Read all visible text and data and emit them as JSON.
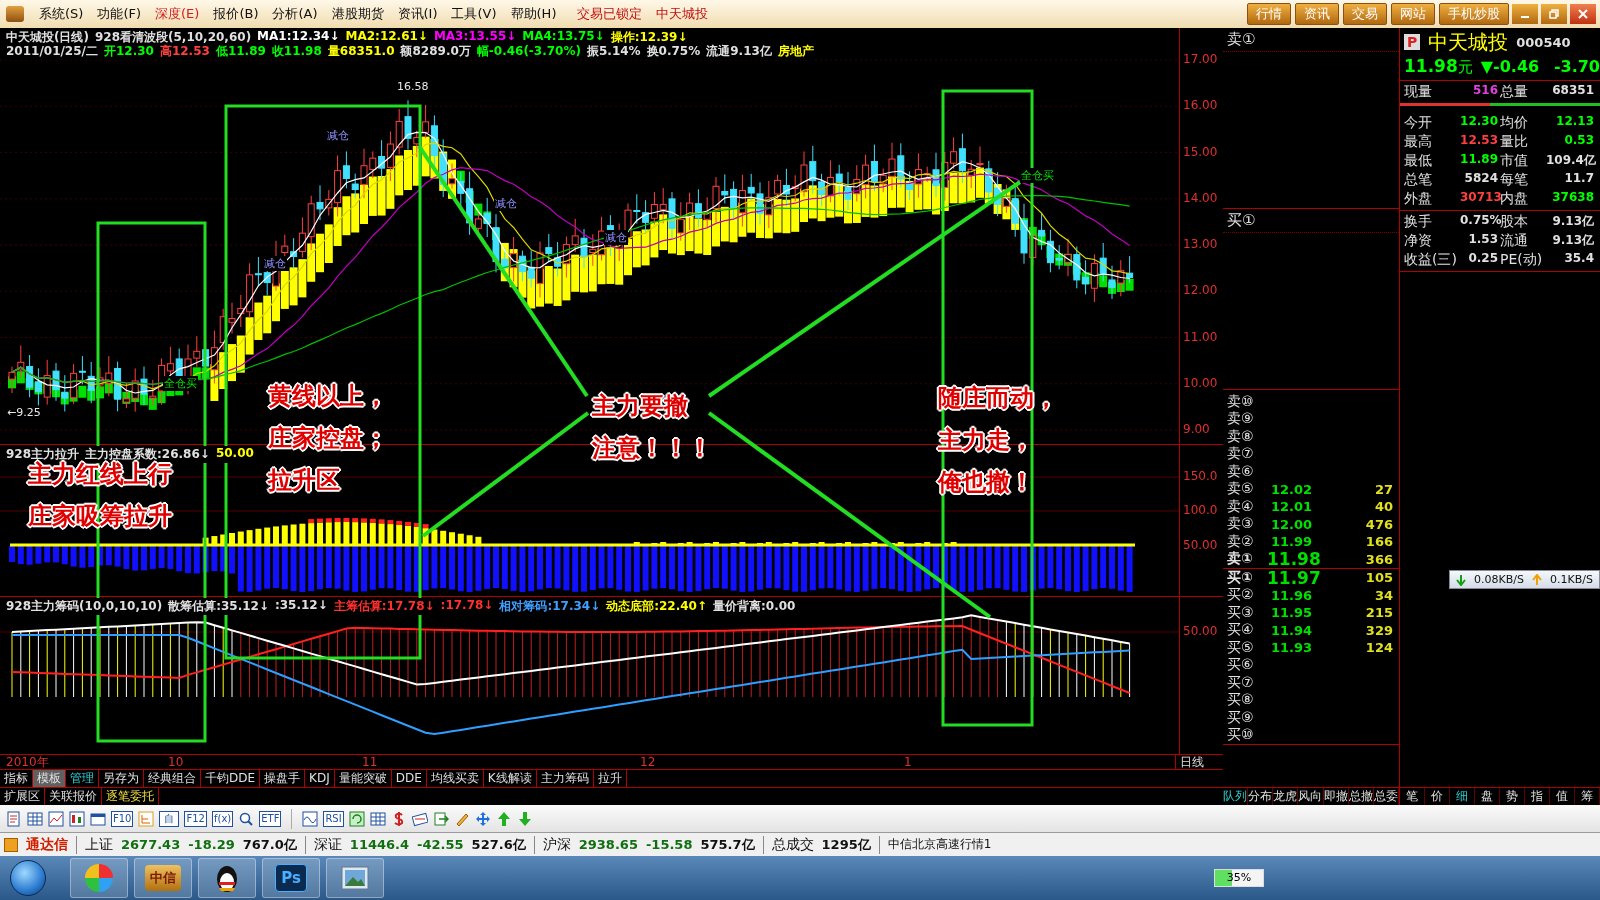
{
  "menu_bar": {
    "items": [
      {
        "label": "系统(S)",
        "selected": false
      },
      {
        "label": "功能(F)",
        "selected": false
      },
      {
        "label": "深度(E)",
        "selected": true
      },
      {
        "label": "报价(B)",
        "selected": false
      },
      {
        "label": "分析(A)",
        "selected": false
      },
      {
        "label": "港股期货",
        "selected": false
      },
      {
        "label": "资讯(I)",
        "selected": false
      },
      {
        "label": "工具(V)",
        "selected": false
      },
      {
        "label": "帮助(H)",
        "selected": false
      }
    ],
    "status_text": "交易已锁定",
    "stock_name": "中天城投",
    "buttons": [
      "行情",
      "资讯",
      "交易",
      "网站",
      "手机炒股"
    ]
  },
  "price_chart": {
    "legend_1": [
      {
        "text": "中天城投(日线)",
        "color": "#e0e0e0"
      },
      {
        "text": "928看清波段(5,10,20,60)",
        "color": "#e0e0e0"
      },
      {
        "text": "MA1:12.34↓",
        "color": "#ffffff"
      },
      {
        "text": "MA2:12.61↓",
        "color": "#ffff00"
      },
      {
        "text": "MA3:13.55↓",
        "color": "#ff00ff"
      },
      {
        "text": "MA4:13.75↓",
        "color": "#00ff00"
      },
      {
        "text": "操作:12.39↓",
        "color": "#ffff00"
      }
    ],
    "legend_2": [
      {
        "text": "2011/01/25/二",
        "color": "#e0e0e0"
      },
      {
        "text": "开12.30",
        "color": "#00ff00"
      },
      {
        "text": "高12.53",
        "color": "#ff4040"
      },
      {
        "text": "低11.89",
        "color": "#00ff00"
      },
      {
        "text": "收11.98",
        "color": "#00ff00"
      },
      {
        "text": "量68351.0",
        "color": "#ffff00"
      },
      {
        "text": "额8289.0万",
        "color": "#e0e0e0"
      },
      {
        "text": "幅-0.46(-3.70%)",
        "color": "#00ff00"
      },
      {
        "text": "振5.14%",
        "color": "#e0e0e0"
      },
      {
        "text": "换0.75%",
        "color": "#e0e0e0"
      },
      {
        "text": "流通9.13亿",
        "color": "#e0e0e0"
      },
      {
        "text": "房地产",
        "color": "#ffff00"
      }
    ],
    "signals": [
      {
        "text": "16.58",
        "kind": "price"
      },
      {
        "text": "减仓",
        "kind": "sell"
      },
      {
        "text": "减仓",
        "kind": "sell"
      },
      {
        "text": "全仓买",
        "kind": "buy"
      },
      {
        "text": "←9.25",
        "kind": "price"
      },
      {
        "text": "减仓",
        "kind": "sell"
      },
      {
        "text": "全仓买",
        "kind": "buy"
      },
      {
        "text": "减仓",
        "kind": "sell"
      }
    ],
    "yticks": [
      "17.00",
      "16.00",
      "15.00",
      "14.00",
      "13.00",
      "12.00",
      "11.00",
      "10.00",
      "9.00"
    ]
  },
  "indicator_1": {
    "legend": [
      {
        "text": "928主力拉升",
        "color": "#e0e0e0"
      },
      {
        "text": "主力控盘系数:26.86↓",
        "color": "#e0e0e0"
      },
      {
        "text": "50.00",
        "color": "#ffff00"
      }
    ],
    "yticks": [
      "150.0",
      "100.0",
      "50.00"
    ]
  },
  "indicator_2": {
    "legend": [
      {
        "text": "928主力筹码(10,0,10,10)",
        "color": "#e0e0e0"
      },
      {
        "text": "散筹估算:35.12↓",
        "color": "#e0e0e0"
      },
      {
        "text": ":35.12↓",
        "color": "#e0e0e0"
      },
      {
        "text": "主筹估算:17.78↓",
        "color": "#ff3030"
      },
      {
        "text": ":17.78↓",
        "color": "#ff3030"
      },
      {
        "text": "相对筹码:17.34↓",
        "color": "#3fa0ff"
      },
      {
        "text": "动态底部:22.40↑",
        "color": "#ffff00"
      },
      {
        "text": "量价背离:0.00",
        "color": "#e0e0e0"
      }
    ],
    "yticks": [
      "50.00"
    ]
  },
  "date_axis": {
    "labels": [
      "2010年",
      "10",
      "11",
      "12",
      "1"
    ],
    "period": "日线"
  },
  "annotations": [
    {
      "text": "主力红线上行"
    },
    {
      "text": "庄家吸筹拉升"
    },
    {
      "text": "黄线以上，"
    },
    {
      "text": "庄家控盘；"
    },
    {
      "text": "拉升区"
    },
    {
      "text": "主力要撤"
    },
    {
      "text": "注意！！！"
    },
    {
      "text": "随庄而动，"
    },
    {
      "text": "主力走，"
    },
    {
      "text": "俺也撤！"
    }
  ],
  "formula_tabs": [
    {
      "label": "指标",
      "selected": false,
      "accent": false
    },
    {
      "label": "模板",
      "selected": true,
      "accent": false
    },
    {
      "label": "管理",
      "selected": false,
      "accent": true
    },
    {
      "label": "另存为",
      "selected": false,
      "accent": false
    },
    {
      "label": "经典组合",
      "selected": false,
      "accent": false
    },
    {
      "label": "千钧DDE",
      "selected": false,
      "accent": false
    },
    {
      "label": "操盘手",
      "selected": false,
      "accent": false
    },
    {
      "label": "KDJ",
      "selected": false,
      "accent": false
    },
    {
      "label": "量能突破",
      "selected": false,
      "accent": false
    },
    {
      "label": "DDE",
      "selected": false,
      "accent": false
    },
    {
      "label": "均线买卖",
      "selected": false,
      "accent": false
    },
    {
      "label": "K线解读",
      "selected": false,
      "accent": false
    },
    {
      "label": "主力筹码",
      "selected": false,
      "accent": false
    },
    {
      "label": "拉升",
      "selected": false,
      "accent": false
    }
  ],
  "extra_tabs": [
    {
      "label": "扩展区",
      "accent": false
    },
    {
      "label": "关联报价",
      "accent": false
    },
    {
      "label": "逐笔委托",
      "accent": true
    }
  ],
  "order_book": {
    "minute_sell": "卖①",
    "minute_buy": "买①",
    "levels": [
      {
        "label": "卖⑩",
        "best": false
      },
      {
        "label": "卖⑨",
        "best": false
      },
      {
        "label": "卖⑧",
        "best": false
      },
      {
        "label": "卖⑦",
        "best": false
      },
      {
        "label": "卖⑥",
        "best": false
      },
      {
        "label": "卖⑤",
        "price": "12.02",
        "volume": "27",
        "best": false
      },
      {
        "label": "卖④",
        "price": "12.01",
        "volume": "40",
        "best": false
      },
      {
        "label": "卖③",
        "price": "12.00",
        "volume": "476",
        "best": false
      },
      {
        "label": "卖②",
        "price": "11.99",
        "volume": "166",
        "best": false
      },
      {
        "label": "卖①",
        "price": "11.98",
        "volume": "366",
        "best": true
      },
      {
        "label": "买①",
        "price": "11.97",
        "volume": "105",
        "best": true
      },
      {
        "label": "买②",
        "price": "11.96",
        "volume": "34",
        "best": false
      },
      {
        "label": "买③",
        "price": "11.95",
        "volume": "215",
        "best": false
      },
      {
        "label": "买④",
        "price": "11.94",
        "volume": "329",
        "best": false
      },
      {
        "label": "买⑤",
        "price": "11.93",
        "volume": "124",
        "best": false
      },
      {
        "label": "买⑥",
        "best": false
      },
      {
        "label": "买⑦",
        "best": false
      },
      {
        "label": "买⑧",
        "best": false
      },
      {
        "label": "买⑨",
        "best": false
      },
      {
        "label": "买⑩",
        "best": false
      }
    ],
    "tabs": [
      {
        "label": "队列",
        "selected": true
      },
      {
        "label": "分布",
        "selected": false
      },
      {
        "label": "龙虎",
        "selected": false
      },
      {
        "label": "风向",
        "selected": false
      },
      {
        "label": "即撤",
        "selected": false
      },
      {
        "label": "总撤",
        "selected": false
      },
      {
        "label": "总委",
        "selected": false
      }
    ]
  },
  "quote": {
    "badge": "P",
    "name": "中天城投",
    "code": "000540",
    "price": "11.98",
    "unit": "元",
    "change": "▼-0.46",
    "change_pct": "-3.70",
    "volume_row": [
      {
        "label": "现量",
        "value": "516",
        "color": "#e040e0"
      },
      {
        "label": "总量",
        "value": "68351",
        "color": "#e0e0e0"
      }
    ],
    "buy_sell_bar": {
      "level": 0.45
    },
    "stats": [
      {
        "label": "今开",
        "value": "12.30",
        "color": "#00ff00"
      },
      {
        "label": "均价",
        "value": "12.13",
        "color": "#00ff00"
      },
      {
        "label": "最高",
        "value": "12.53",
        "color": "#ff4040"
      },
      {
        "label": "量比",
        "value": "0.53",
        "color": "#00ff00"
      },
      {
        "label": "最低",
        "value": "11.89",
        "color": "#00ff00"
      },
      {
        "label": "市值",
        "value": "109.4亿",
        "color": "#e0e0e0"
      },
      {
        "label": "总笔",
        "value": "5824",
        "color": "#e0e0e0"
      },
      {
        "label": "每笔",
        "value": "11.7",
        "color": "#e0e0e0"
      },
      {
        "label": "外盘",
        "value": "30713",
        "color": "#ff4040"
      },
      {
        "label": "内盘",
        "value": "37638",
        "color": "#00ff00"
      }
    ],
    "stats_2": [
      {
        "label": "换手",
        "value": "0.75%"
      },
      {
        "label": "股本",
        "value": "9.13亿"
      },
      {
        "label": "净资",
        "value": "1.53"
      },
      {
        "label": "流通",
        "value": "9.13亿"
      },
      {
        "label": "收益(三)",
        "value": "0.25"
      },
      {
        "label": "PE(动)",
        "value": "35.4"
      }
    ],
    "net_speed": {
      "down": "0.08KB/S",
      "up": "0.1KB/S"
    },
    "tabs": [
      {
        "label": "笔",
        "selected": false
      },
      {
        "label": "价",
        "selected": false
      },
      {
        "label": "细",
        "selected": true
      },
      {
        "label": "盘",
        "selected": false
      },
      {
        "label": "势",
        "selected": false
      },
      {
        "label": "指",
        "selected": false
      },
      {
        "label": "值",
        "selected": false
      },
      {
        "label": "筹",
        "selected": false
      }
    ]
  },
  "toolbar": [
    {
      "kind": "doc"
    },
    {
      "kind": "grid"
    },
    {
      "kind": "line"
    },
    {
      "kind": "candle"
    },
    {
      "kind": "window"
    },
    {
      "kind": "text",
      "text": "F10"
    },
    {
      "kind": "tree"
    },
    {
      "kind": "text",
      "text": "自"
    },
    {
      "kind": "text",
      "text": "F12"
    },
    {
      "kind": "text",
      "text": "f(x)"
    },
    {
      "kind": "search"
    },
    {
      "kind": "text",
      "text": "ETF"
    },
    {
      "kind": "separator"
    },
    {
      "kind": "wave"
    },
    {
      "kind": "text",
      "text": "RSI"
    },
    {
      "kind": "refresh"
    },
    {
      "kind": "grid"
    },
    {
      "kind": "dollar"
    },
    {
      "kind": "card"
    },
    {
      "kind": "exit"
    },
    {
      "kind": "pencil"
    },
    {
      "kind": "move"
    },
    {
      "kind": "up"
    },
    {
      "kind": "down"
    }
  ],
  "status_bar": {
    "brand": "通达信",
    "indices": [
      {
        "name": "上证",
        "value": "2677.43",
        "change": "-18.29",
        "amount": "767.0亿"
      },
      {
        "name": "深证",
        "value": "11446.4",
        "change": "-42.55",
        "amount": "527.6亿"
      },
      {
        "name": "沪深",
        "value": "2938.65",
        "change": "-15.58",
        "amount": "575.7亿"
      }
    ],
    "total_label": "总成交",
    "total": "1295亿",
    "server": "中信北京高速行情1"
  },
  "taskbar": {
    "apps": [
      {
        "kind": "pinwheel"
      },
      {
        "kind": "label",
        "text": "中信"
      },
      {
        "kind": "penguin"
      },
      {
        "kind": "label",
        "text": "Ps"
      },
      {
        "kind": "photo"
      }
    ],
    "gauge": "35%"
  }
}
